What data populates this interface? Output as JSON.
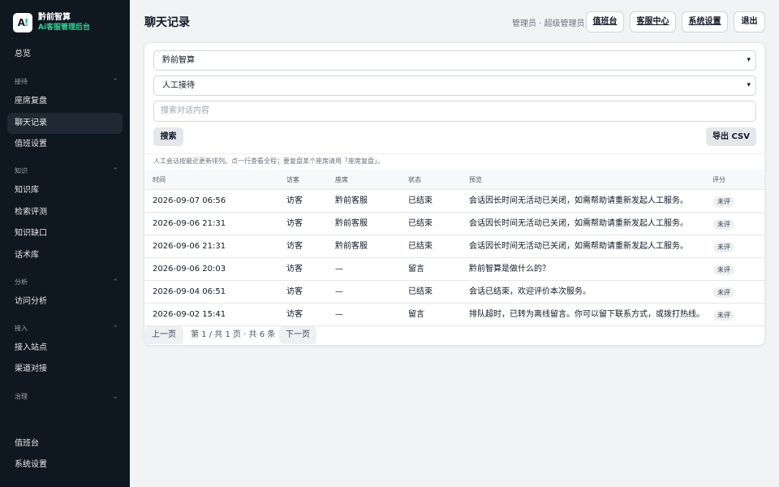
{
  "sidebar": {
    "brand": {
      "logo": "A!",
      "name": "黔前智算",
      "subtitle": "Ai客服管理后台"
    },
    "overview": "总览",
    "sections": {
      "reception": {
        "label": "接待",
        "items": [
          "座席复盘",
          "聊天记录",
          "值班设置"
        ]
      },
      "knowledge": {
        "label": "知识",
        "items": [
          "知识库",
          "检索评测",
          "知识缺口",
          "话术库"
        ]
      },
      "analysis": {
        "label": "分析",
        "items": [
          "访问分析"
        ]
      },
      "integration": {
        "label": "接入",
        "items": [
          "接入站点",
          "渠道对接"
        ]
      },
      "governance": {
        "label": "治理"
      }
    },
    "bottom": [
      "值班台",
      "系统设置"
    ],
    "active_item": "聊天记录"
  },
  "header": {
    "title": "聊天记录",
    "role": "管理员 · 超级管理员",
    "buttons": [
      "值班台",
      "客服中心",
      "系统设置",
      "退出"
    ]
  },
  "filters": {
    "tenant_select": "黔前智算",
    "mode_select": "人工接待",
    "search_placeholder": "搜索对话内容",
    "search_button": "搜索",
    "export_button": "导出 CSV",
    "hint": "人工会话按最近更新排列。点一行查看全程；要复盘某个座席请用「座席复盘」。"
  },
  "table": {
    "columns": [
      "时间",
      "访客",
      "座席",
      "状态",
      "预览",
      "评分"
    ],
    "rows": [
      {
        "time": "2026-09-07 06:56",
        "visitor": "访客",
        "agent": "黔前客服",
        "status": "已结束",
        "preview": "会话因长时间无活动已关闭，如需帮助请重新发起人工服务。",
        "rating": "未评"
      },
      {
        "time": "2026-09-06 21:31",
        "visitor": "访客",
        "agent": "黔前客服",
        "status": "已结束",
        "preview": "会话因长时间无活动已关闭，如需帮助请重新发起人工服务。",
        "rating": "未评"
      },
      {
        "time": "2026-09-06 21:31",
        "visitor": "访客",
        "agent": "黔前客服",
        "status": "已结束",
        "preview": "会话因长时间无活动已关闭，如需帮助请重新发起人工服务。",
        "rating": "未评"
      },
      {
        "time": "2026-09-06 20:03",
        "visitor": "访客",
        "agent": "—",
        "status": "留言",
        "preview": "黔前智算是做什么的？",
        "rating": "未评"
      },
      {
        "time": "2026-09-04 06:51",
        "visitor": "访客",
        "agent": "—",
        "status": "已结束",
        "preview": "会话已结束，欢迎评价本次服务。",
        "rating": "未评"
      },
      {
        "time": "2026-09-02 15:41",
        "visitor": "访客",
        "agent": "—",
        "status": "留言",
        "preview": "排队超时，已转为离线留言。你可以留下联系方式，或拨打热线。",
        "rating": "未评"
      }
    ]
  },
  "pagination": {
    "prev": "上一页",
    "info": "第 1 / 共 1 页 · 共 6 条",
    "next": "下一页"
  },
  "colors": {
    "sidebar_bg": "#0f1720",
    "accent": "#34d399",
    "page_bg": "#f1f3f5"
  }
}
